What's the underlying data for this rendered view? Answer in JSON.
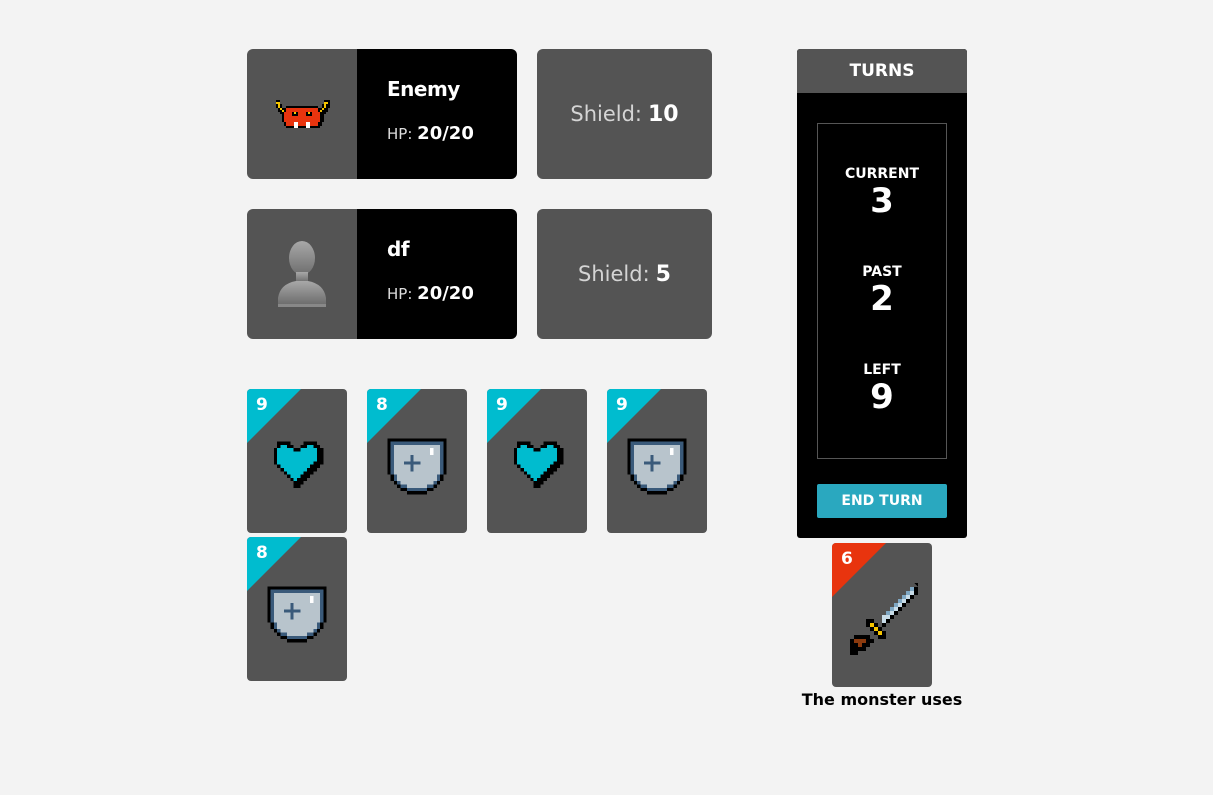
{
  "enemy": {
    "name": "Enemy",
    "hp_label": "HP:",
    "hp_value": "20/20",
    "shield_label": "Shield:",
    "shield_value": "10",
    "avatar_icon": "demon-icon"
  },
  "player": {
    "name": "df",
    "hp_label": "HP:",
    "hp_value": "20/20",
    "shield_label": "Shield:",
    "shield_value": "5",
    "avatar_icon": "user-silhouette-icon"
  },
  "hand": [
    {
      "cost": "9",
      "icon": "heart-icon"
    },
    {
      "cost": "8",
      "icon": "shield-icon"
    },
    {
      "cost": "9",
      "icon": "heart-icon"
    },
    {
      "cost": "9",
      "icon": "shield-icon"
    },
    {
      "cost": "8",
      "icon": "shield-icon"
    }
  ],
  "turns": {
    "title": "TURNS",
    "current_label": "CURRENT",
    "current_value": "3",
    "past_label": "PAST",
    "past_value": "2",
    "left_label": "LEFT",
    "left_value": "9",
    "end_turn_label": "END TURN"
  },
  "monster_card": {
    "cost": "6",
    "icon": "sword-icon",
    "caption": "The monster uses"
  },
  "colors": {
    "card_corner": "#00bccf",
    "monster_corner": "#e8340e",
    "button": "#2aa8bf",
    "panel": "#545454"
  }
}
